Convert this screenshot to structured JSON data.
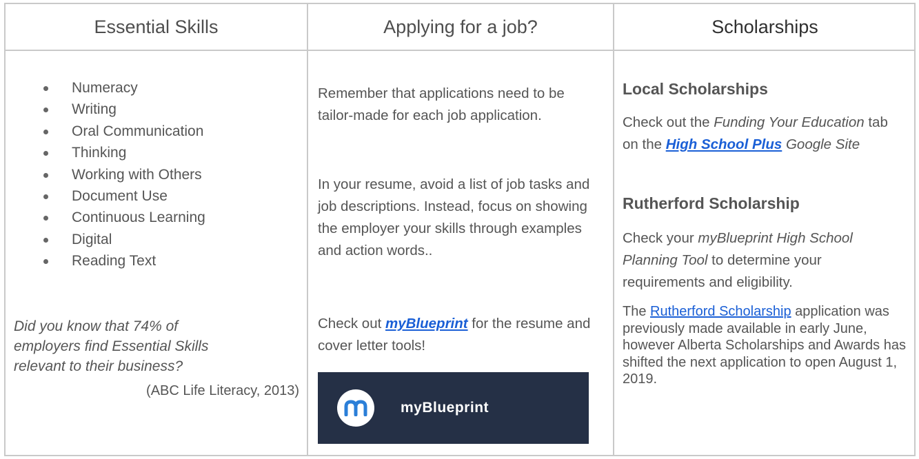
{
  "headers": {
    "col1": "Essential Skills",
    "col2": "Applying for a job?",
    "col3": "Scholarships"
  },
  "skills": {
    "items": [
      "Numeracy",
      "Writing",
      "Oral Communication",
      "Thinking",
      "Working with Others",
      "Document Use",
      "Continuous Learning",
      "Digital",
      "Reading Text"
    ],
    "fact_line1": "Did you know that 74% of",
    "fact_line2": "employers find Essential Skills",
    "fact_line3": "relevant to their business?",
    "citation": "(ABC Life Literacy, 2013)"
  },
  "job": {
    "para1": "Remember that applications need to be tailor-made for each job application.",
    "para2": "In your resume, avoid a list of job tasks and job descriptions. Instead, focus on showing the employer your skills through examples and action words..",
    "para3_prefix": "Check out ",
    "para3_link": "myBlueprint",
    "para3_suffix": " for the resume and cover letter tools!",
    "banner_text": "myBlueprint"
  },
  "scholarships": {
    "local_title": "Local Scholarships",
    "local_p1": "Check out the ",
    "local_italic": "Funding Your Education",
    "local_p2": " tab on the ",
    "local_link": "High School Plus",
    "local_p3": " Google Site",
    "rutherford_title": "Rutherford Scholarship",
    "rut_p1": "Check your ",
    "rut_italic": "myBlueprint High School Planning Tool",
    "rut_p2": " to determine your requirements and eligibility.",
    "rut2_prefix": "The ",
    "rut2_link": "Rutherford Scholarship",
    "rut2_text": " application was previously made available in early June, however Alberta Scholarships and Awards has shifted the next application to open August 1, 2019."
  },
  "colors": {
    "border": "#c9c9c9",
    "link": "#1a5fd6",
    "banner_bg": "#253046",
    "text": "#555555"
  }
}
